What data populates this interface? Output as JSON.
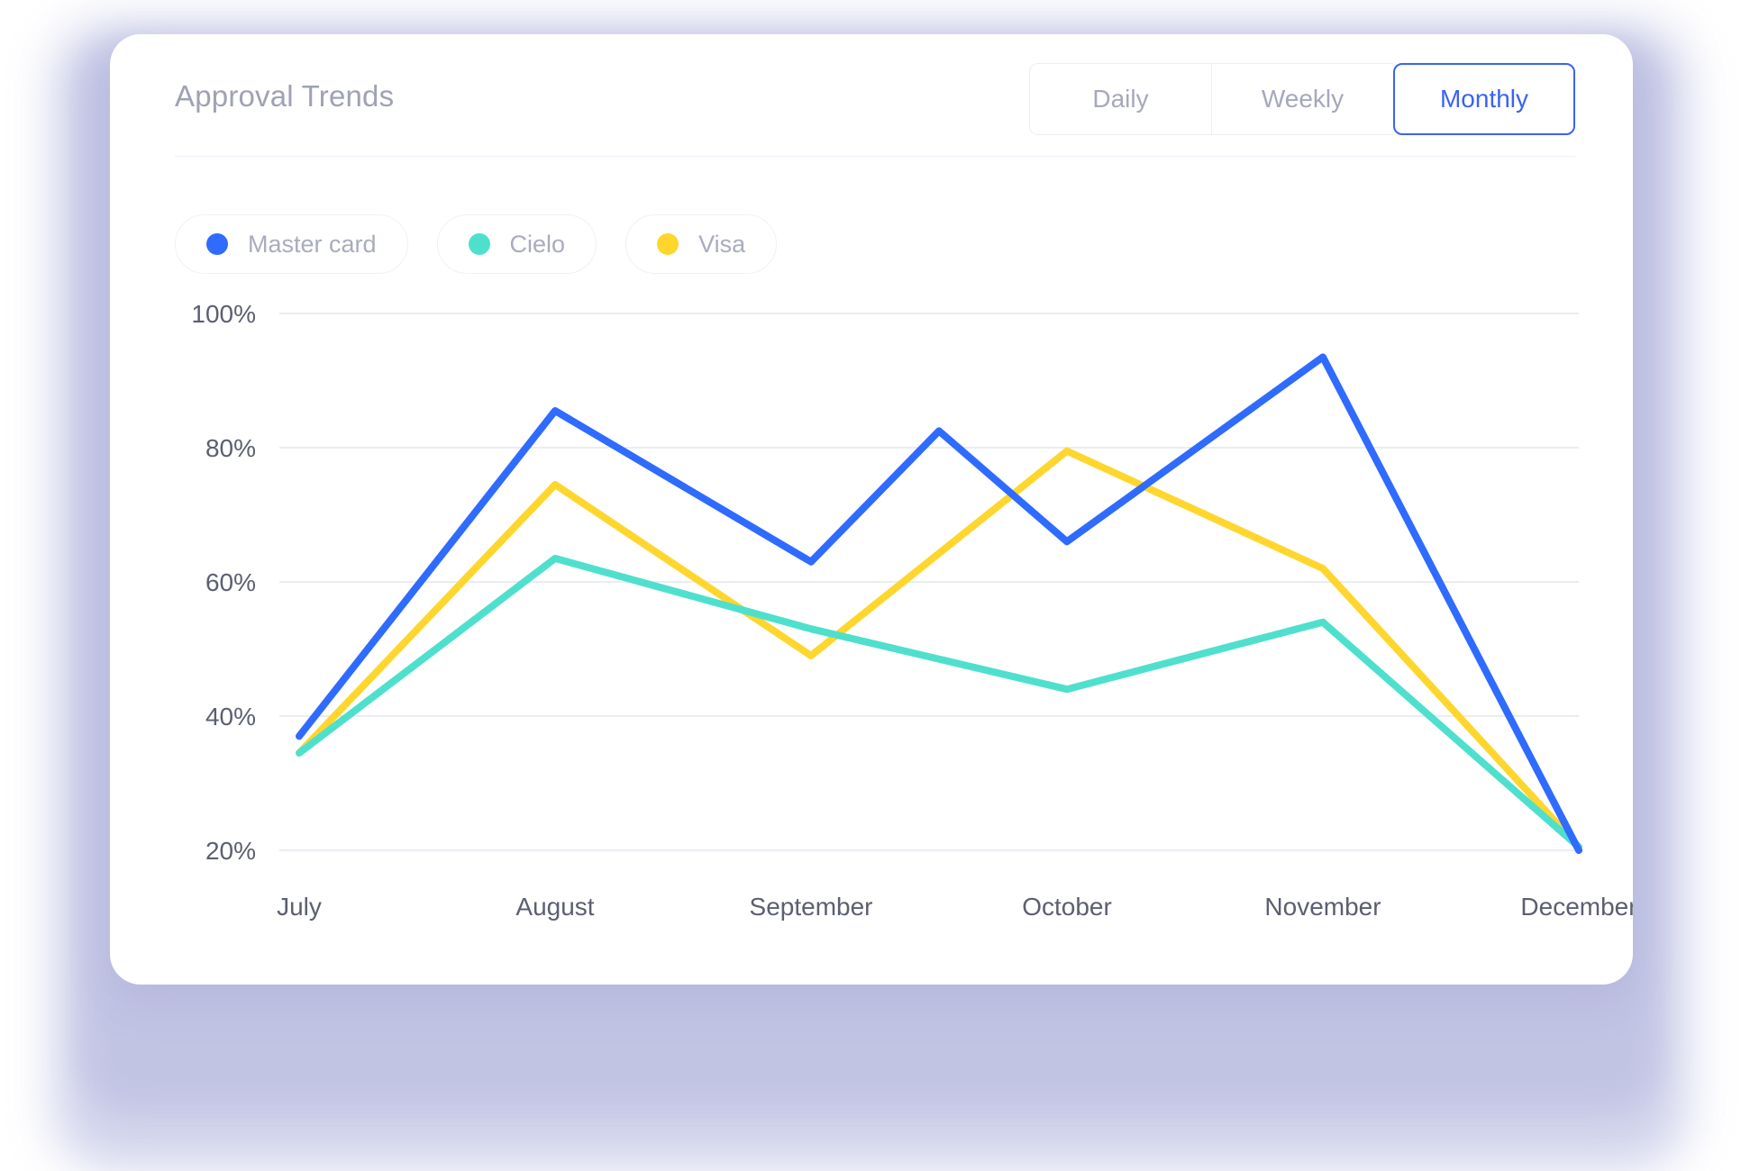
{
  "header": {
    "title": "Approval Trends"
  },
  "range_tabs": {
    "items": [
      {
        "label": "Daily",
        "active": false
      },
      {
        "label": "Weekly",
        "active": false
      },
      {
        "label": "Monthly",
        "active": true
      }
    ],
    "active_label": "Monthly",
    "active_color": "#3b62f6"
  },
  "legend": {
    "items": [
      {
        "label": "Master card",
        "color": "#2f6bff"
      },
      {
        "label": "Cielo",
        "color": "#4fe0cd"
      },
      {
        "label": "Visa",
        "color": "#ffd62e"
      }
    ]
  },
  "chart_data": {
    "type": "line",
    "title": "Approval Trends",
    "xlabel": "",
    "ylabel": "",
    "ylim": [
      20,
      100
    ],
    "yticks": [
      100,
      80,
      60,
      40,
      20
    ],
    "ytick_labels": [
      "100%",
      "80%",
      "60%",
      "40%",
      "20%"
    ],
    "grid": true,
    "legend_position": "top-left",
    "categories": [
      "July",
      "August",
      "September",
      "October",
      "November",
      "December"
    ],
    "series": [
      {
        "name": "Master card",
        "color": "#2f6bff",
        "values": [
          37,
          85.5,
          63,
          66,
          93.5,
          20
        ],
        "midpoints": [
          {
            "after": "September",
            "value": 82.5
          }
        ]
      },
      {
        "name": "Cielo",
        "color": "#4fe0cd",
        "values": [
          34.5,
          63.5,
          53,
          44,
          54,
          20.5
        ]
      },
      {
        "name": "Visa",
        "color": "#ffd62e",
        "values": [
          34.5,
          74.5,
          49,
          79.5,
          62,
          20.5
        ]
      }
    ]
  }
}
